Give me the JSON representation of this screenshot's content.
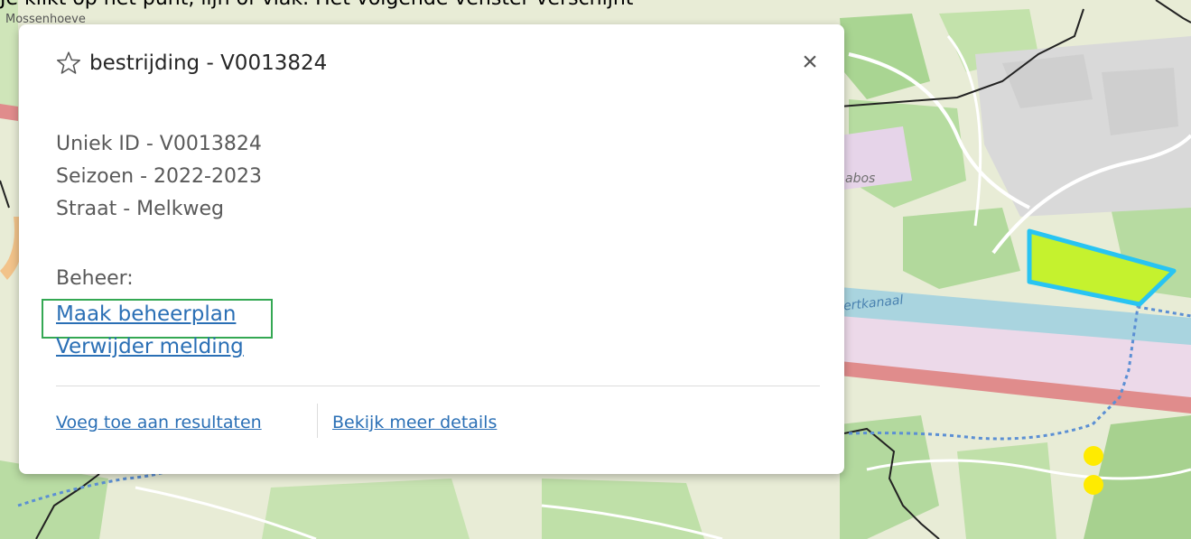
{
  "instruction_caption": "Je klikt op het punt, lijn of vlak. Het volgende venster verschijnt",
  "map": {
    "labels": [
      "Mossenhoeve",
      "abos",
      "ertkanaal"
    ]
  },
  "popup": {
    "title": "bestrijding - V0013824",
    "star_icon": "star-outline-icon",
    "close_label": "×",
    "attributes": [
      "Uniek ID - V0013824",
      "Seizoen - 2022-2023",
      "Straat - Melkweg"
    ],
    "beheer_label": "Beheer:",
    "actions": {
      "maak_beheerplan": "Maak beheerplan",
      "verwijder_melding": "Verwijder melding"
    },
    "footer": {
      "add_to_results": "Voeg toe aan resultaten",
      "view_details": "Bekijk meer details"
    }
  },
  "colors": {
    "link": "#2a6fb5",
    "highlight": "#34a853",
    "polygon_fill": "#c5f22e",
    "polygon_stroke": "#28c4f2",
    "marker": "#ffeb00"
  }
}
